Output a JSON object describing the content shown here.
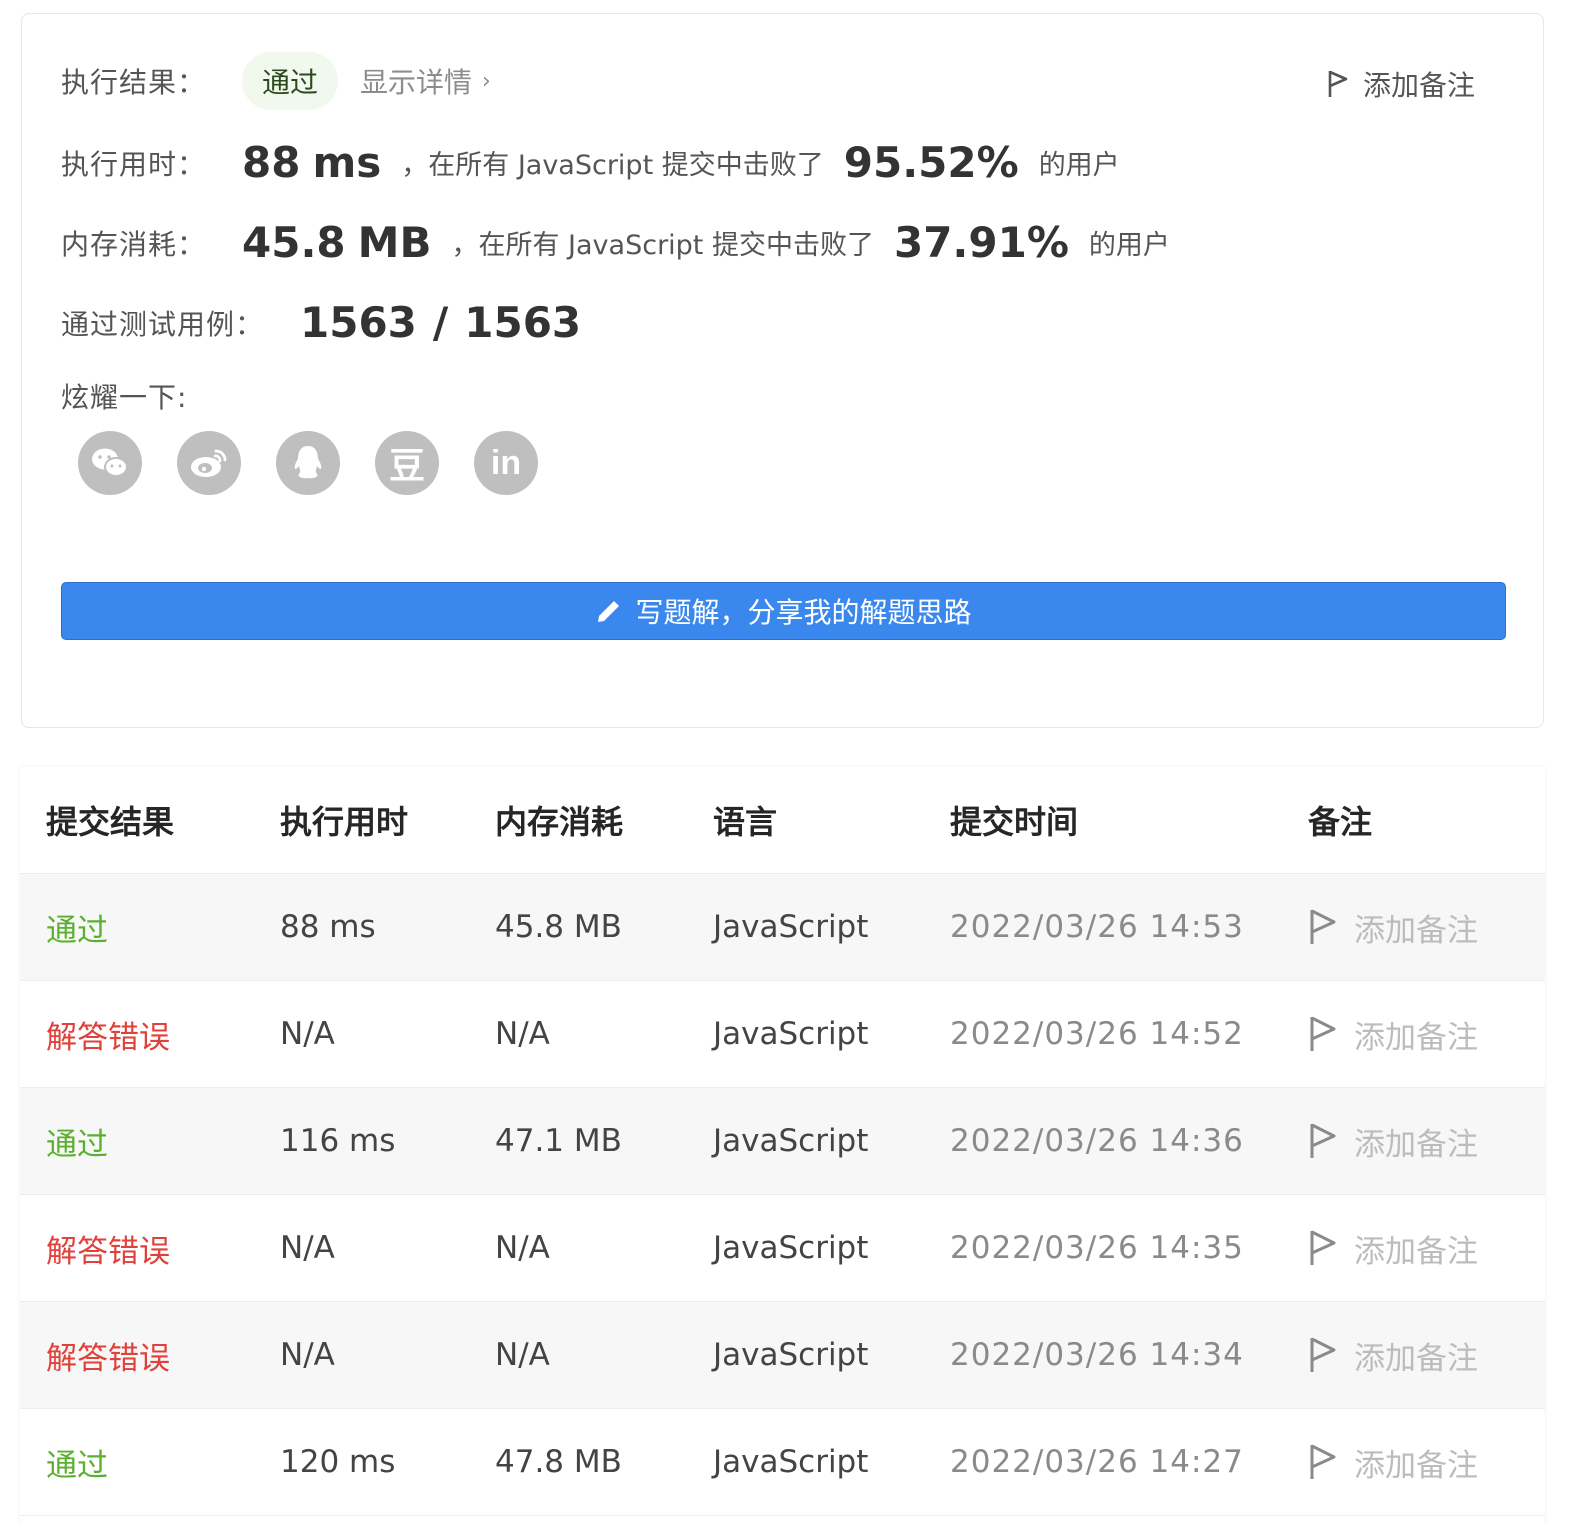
{
  "result": {
    "label": "执行结果：",
    "badge": "通过",
    "details": "显示详情",
    "add_note": "添加备注"
  },
  "runtime": {
    "label": "执行用时：",
    "value": "88",
    "unit": "ms",
    "text": "，在所有 JavaScript 提交中击败了",
    "percent": "95.52%",
    "suffix": "的用户"
  },
  "memory": {
    "label": "内存消耗：",
    "value": "45.8",
    "unit": "MB",
    "text": "，在所有 JavaScript 提交中击败了",
    "percent": "37.91%",
    "suffix": "的用户"
  },
  "tests": {
    "label": "通过测试用例：",
    "passed": "1563",
    "separator": "/",
    "total": "1563"
  },
  "share": {
    "label": "炫耀一下:",
    "icons": [
      "wechat-icon",
      "weibo-icon",
      "qq-icon",
      "douban-icon",
      "linkedin-icon"
    ],
    "douban_glyph": "豆",
    "linkedin_glyph": "in"
  },
  "write_button": "写题解，分享我的解题思路",
  "table": {
    "headers": [
      "提交结果",
      "执行用时",
      "内存消耗",
      "语言",
      "提交时间",
      "备注"
    ],
    "rows": [
      {
        "status": "通过",
        "runtime": "88 ms",
        "memory": "45.8 MB",
        "language": "JavaScript",
        "time": "2022/03/26 14:53",
        "note": "添加备注"
      },
      {
        "status": "解答错误",
        "runtime": "N/A",
        "memory": "N/A",
        "language": "JavaScript",
        "time": "2022/03/26 14:52",
        "note": "添加备注"
      },
      {
        "status": "通过",
        "runtime": "116 ms",
        "memory": "47.1 MB",
        "language": "JavaScript",
        "time": "2022/03/26 14:36",
        "note": "添加备注"
      },
      {
        "status": "解答错误",
        "runtime": "N/A",
        "memory": "N/A",
        "language": "JavaScript",
        "time": "2022/03/26 14:35",
        "note": "添加备注"
      },
      {
        "status": "解答错误",
        "runtime": "N/A",
        "memory": "N/A",
        "language": "JavaScript",
        "time": "2022/03/26 14:34",
        "note": "添加备注"
      },
      {
        "status": "通过",
        "runtime": "120 ms",
        "memory": "47.8 MB",
        "language": "JavaScript",
        "time": "2022/03/26 14:27",
        "note": "添加备注"
      }
    ]
  },
  "colors": {
    "pass": "#5bb031",
    "fail": "#e0413a",
    "primary": "#3a88ee",
    "badge_bg": "#f1f8ee"
  }
}
